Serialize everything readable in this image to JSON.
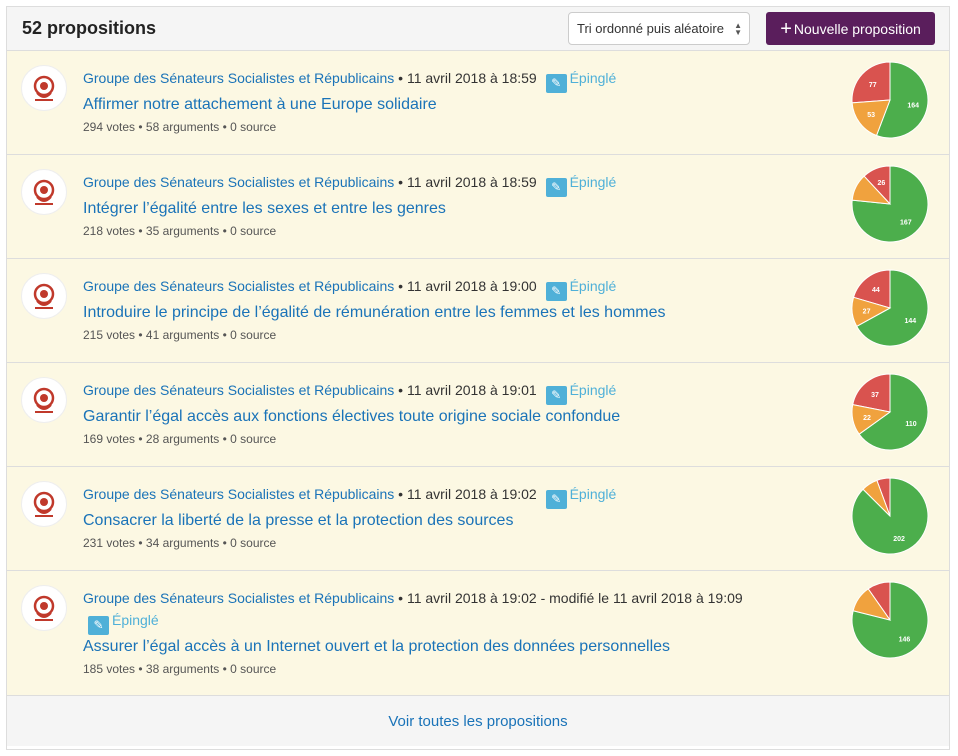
{
  "header": {
    "title": "52 propositions",
    "sort_value": "Tri ordonné puis aléatoire",
    "new_button_label": "Nouvelle proposition"
  },
  "colors": {
    "accent": "#5a1e5c",
    "link": "#1a73b8",
    "pin": "#4fb0d8",
    "row_bg": "#fcf8e3",
    "pie_for": "#4cae4c",
    "pie_mixed": "#f0a23e",
    "pie_against": "#d9534f"
  },
  "items": [
    {
      "author": "Groupe des Sénateurs Socialistes et Républicains",
      "date": " • 11 avril 2018 à 18:59",
      "pinned_label": "Épinglé",
      "title": "Affirmer notre attachement à une Europe solidaire",
      "stats": "294 votes • 58 arguments • 0 source",
      "votes": {
        "for": 164,
        "mixed": 53,
        "against": 77
      },
      "labels": {
        "for": "164",
        "mixed": "53",
        "against": "77"
      }
    },
    {
      "author": "Groupe des Sénateurs Socialistes et Républicains",
      "date": " • 11 avril 2018 à 18:59",
      "pinned_label": "Épinglé",
      "title": "Intégrer l’égalité entre les sexes et entre les genres",
      "stats": "218 votes • 35 arguments • 0 source",
      "votes": {
        "for": 167,
        "mixed": 25,
        "against": 26
      },
      "labels": {
        "for": "167",
        "mixed": "",
        "against": "26"
      }
    },
    {
      "author": "Groupe des Sénateurs Socialistes et Républicains",
      "date": " • 11 avril 2018 à 19:00",
      "pinned_label": "Épinglé",
      "title": "Introduire le principe de l’égalité de rémunération entre les femmes et les hommes",
      "stats": "215 votes • 41 arguments • 0 source",
      "votes": {
        "for": 144,
        "mixed": 27,
        "against": 44
      },
      "labels": {
        "for": "144",
        "mixed": "27",
        "against": "44"
      }
    },
    {
      "author": "Groupe des Sénateurs Socialistes et Républicains",
      "date": " • 11 avril 2018 à 19:01",
      "pinned_label": "Épinglé",
      "title": "Garantir l’égal accès aux fonctions électives toute origine sociale confondue",
      "stats": "169 votes • 28 arguments • 0 source",
      "votes": {
        "for": 110,
        "mixed": 22,
        "against": 37
      },
      "labels": {
        "for": "110",
        "mixed": "22",
        "against": "37"
      }
    },
    {
      "author": "Groupe des Sénateurs Socialistes et Républicains",
      "date": " • 11 avril 2018 à 19:02",
      "pinned_label": "Épinglé",
      "title": "Consacrer la liberté de la presse et la protection des sources",
      "stats": "231 votes • 34 arguments • 0 source",
      "votes": {
        "for": 202,
        "mixed": 16,
        "against": 13
      },
      "labels": {
        "for": "202",
        "mixed": "",
        "against": ""
      }
    },
    {
      "author": "Groupe des Sénateurs Socialistes et Républicains",
      "date": " • 11 avril 2018 à 19:02 - modifié le 11 avril 2018 à 19:09",
      "pinned_label": "Épinglé",
      "title": "Assurer l’égal accès à un Internet ouvert et la protection des données personnelles",
      "stats": "185 votes • 38 arguments • 0 source",
      "votes": {
        "for": 146,
        "mixed": 21,
        "against": 18
      },
      "labels": {
        "for": "146",
        "mixed": "",
        "against": ""
      }
    }
  ],
  "footer": {
    "see_all_label": "Voir toutes les propositions"
  }
}
